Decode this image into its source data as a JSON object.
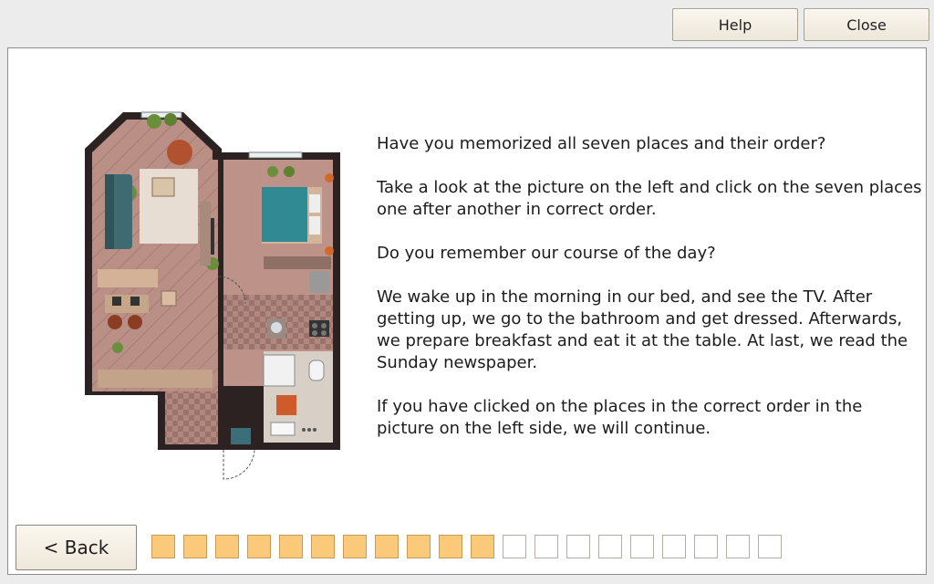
{
  "toolbar": {
    "help_label": "Help",
    "close_label": "Close"
  },
  "instructions": {
    "p1": "Have you memorized all seven places and their order?",
    "p2": "Take a look at the picture on the left and click on the seven places one after another in correct order.",
    "p3": "Do you remember our course of the day?",
    "p4": "We wake up in the morning in our bed, and see the TV. After getting up, we go to the bathroom and get dressed. Afterwards, we prepare breakfast and eat it at the table. At last, we read the Sunday newspaper.",
    "p5": "If you have clicked on the places in the correct order in the picture on the left side, we will continue."
  },
  "navigation": {
    "back_label": "< Back"
  },
  "progress": {
    "total_steps": 20,
    "completed_steps": 11,
    "completed_color": "#fbc97a"
  }
}
